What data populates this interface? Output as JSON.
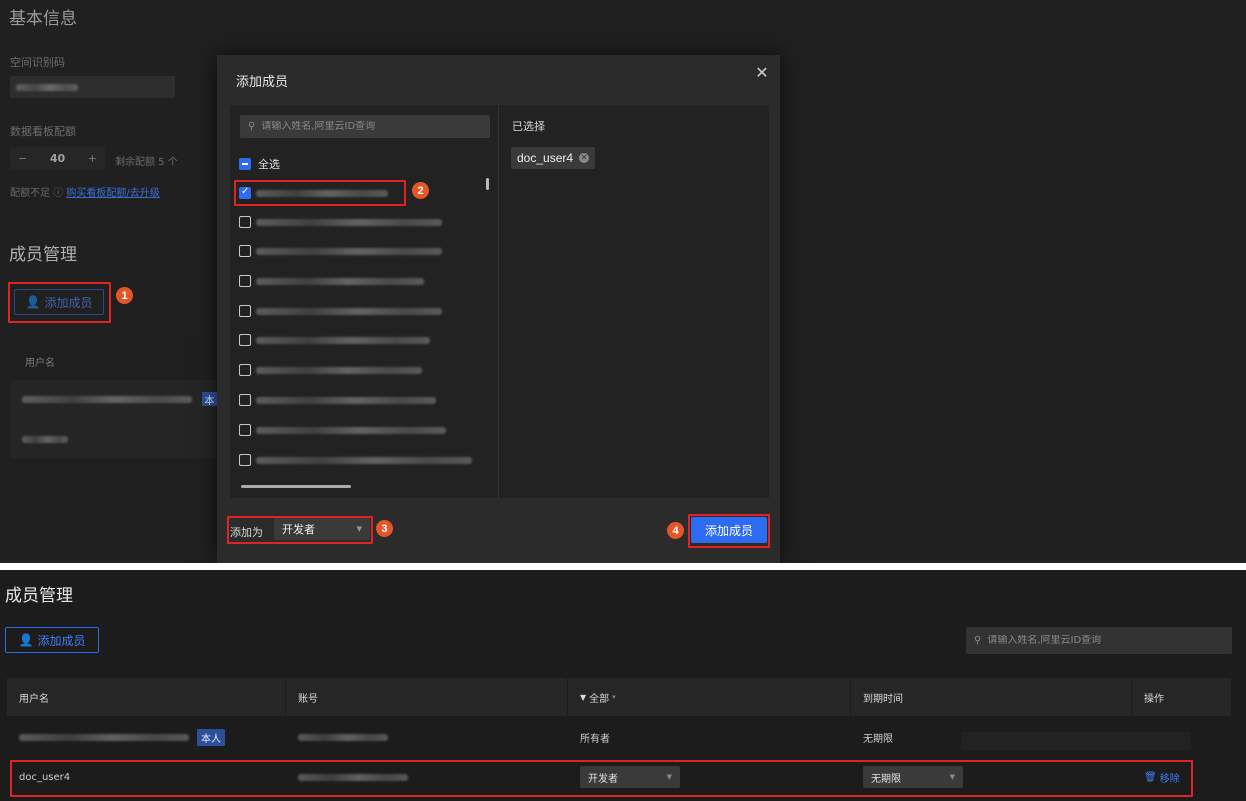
{
  "background_page": {
    "basic_info_title": "基本信息",
    "space_id_label": "空间识别码",
    "dashboard_quota_label": "数据看板配额",
    "quota_minus": "−",
    "quota_value": "40",
    "quota_plus": "+",
    "quota_remaining": "剩余配额 5 个",
    "quota_hint_prefix": "配额不足 ⓘ",
    "quota_hint_link": "购买看板配额/去升级",
    "member_section_title": "成员管理",
    "add_member_label": "添加成员",
    "table_col_username": "用户名",
    "self_badge_partial": "本"
  },
  "modal": {
    "title": "添加成员",
    "search_placeholder": "请输入姓名,阿里云ID查询",
    "select_all_label": "全选",
    "selected_title": "已选择",
    "selected_chip": "doc_user4",
    "add_as_label": "添加为",
    "role_value": "开发者",
    "confirm_button": "添加成员"
  },
  "steps": [
    "1",
    "2",
    "3",
    "4"
  ],
  "member_page": {
    "title": "成员管理",
    "add_member_label": "添加成员",
    "search_placeholder": "请输入姓名,阿里云ID查询",
    "columns": {
      "username": "用户名",
      "account": "账号",
      "role_filter": "全部",
      "expiry": "到期时间",
      "action": "操作"
    },
    "rows": [
      {
        "self_badge": "本人",
        "role": "所有者",
        "expiry": "无期限"
      },
      {
        "username": "doc_user4",
        "role": "开发者",
        "expiry": "无期限",
        "action": "移除"
      }
    ]
  },
  "colors": {
    "accent_blue": "#2d6cf0",
    "highlight_red": "#e02424",
    "step_orange": "#e4552a"
  }
}
